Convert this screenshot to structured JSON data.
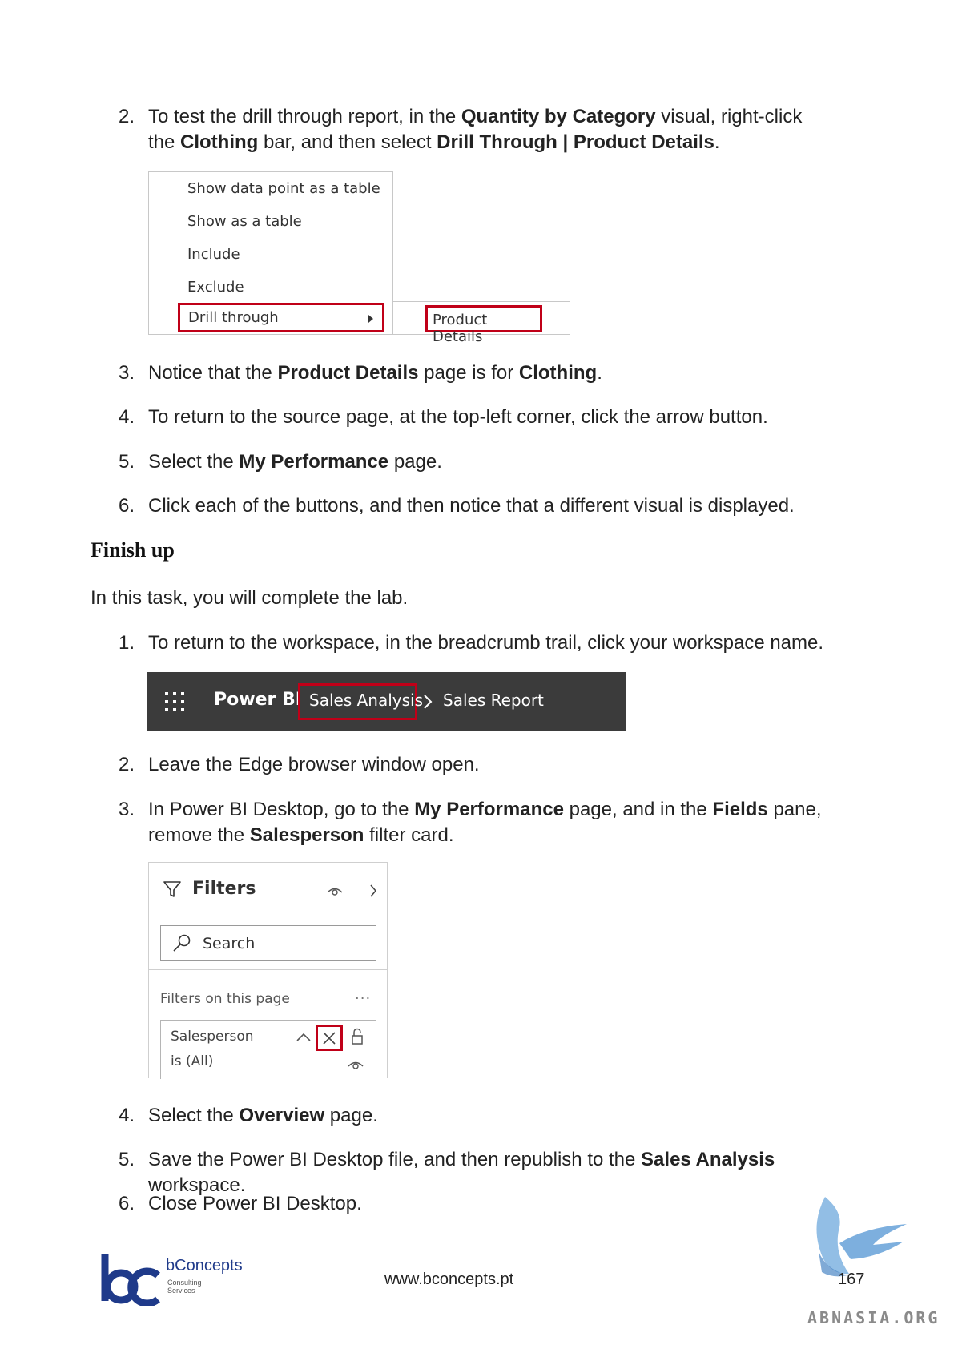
{
  "steps_top": [
    {
      "num": "2.",
      "line1_parts": [
        "To test the drill through report, in the ",
        "Quantity by Category",
        " visual, right-click"
      ],
      "line2_parts": [
        "the ",
        "Clothing",
        " bar, and then select ",
        "Drill Through | Product Details",
        "."
      ]
    },
    {
      "num": "3.",
      "parts": [
        "Notice that the ",
        "Product Details",
        " page is for ",
        "Clothing",
        "."
      ]
    },
    {
      "num": "4.",
      "text": "To return to the source page, at the top-left corner, click the arrow button."
    },
    {
      "num": "5.",
      "parts": [
        "Select the ",
        "My Performance",
        " page."
      ]
    },
    {
      "num": "6.",
      "text": "Click each of the buttons, and then notice that a different visual is displayed."
    }
  ],
  "context_menu": {
    "items": [
      "Show data point as a table",
      "Show as a table",
      "Include",
      "Exclude",
      "Drill through"
    ],
    "submenu_item": "Product Details"
  },
  "section_heading": "Finish up",
  "intro": "In this task, you will complete the lab.",
  "steps_bottom": [
    {
      "num": "1.",
      "text": "To return to the workspace, in the breadcrumb trail, click your workspace name."
    },
    {
      "num": "2.",
      "text": "Leave the Edge browser window open."
    },
    {
      "num": "3.",
      "line1_parts": [
        "In Power BI Desktop, go to the ",
        "My Performance",
        " page, and in the ",
        "Fields",
        " pane,"
      ],
      "line2_parts": [
        "remove the ",
        "Salesperson",
        " filter card."
      ]
    },
    {
      "num": "4.",
      "parts": [
        "Select the ",
        "Overview",
        " page."
      ]
    },
    {
      "num": "5.",
      "parts": [
        "Save the Power BI Desktop file, and then republish to the ",
        "Sales Analysis",
        " workspace."
      ]
    },
    {
      "num": "6.",
      "text": "Close Power BI Desktop."
    }
  ],
  "breadcrumb": {
    "app": "Power BI",
    "workspace": "Sales Analysis",
    "separator": ">",
    "report": "Sales Report"
  },
  "filters_pane": {
    "title": "Filters",
    "search_placeholder": "Search",
    "section_label": "Filters on this page",
    "more": "...",
    "card_field": "Salesperson",
    "card_value": "is (All)"
  },
  "footer": {
    "brand": "bConcepts",
    "brand_sub1": "Consulting",
    "brand_sub2": "Services",
    "url": "www.bconcepts.pt",
    "page_number": "167",
    "watermark": "ABNASIA.ORG"
  },
  "colors": {
    "highlight": "#c00018",
    "bar_bg": "#3b3b3b",
    "brand_blue": "#1f3a8a",
    "bird_blue": "#7fb3e0"
  }
}
